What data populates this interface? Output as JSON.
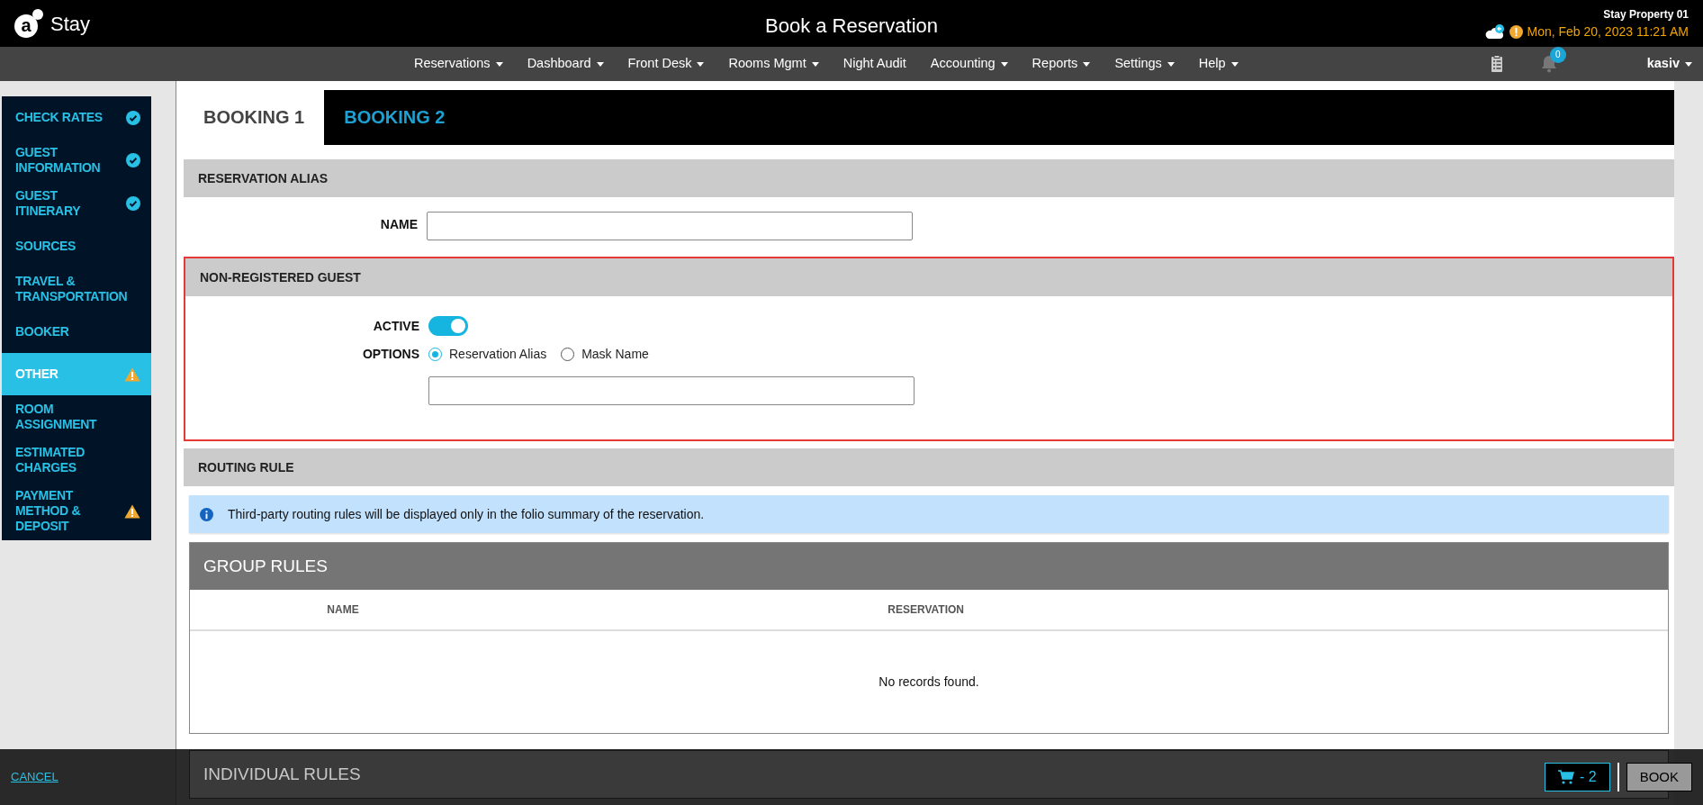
{
  "header": {
    "logo_mark": "a",
    "logo_name": "Stay",
    "title": "Book a Reservation",
    "property": "Stay Property 01",
    "datetime": "Mon, Feb 20, 2023 11:21 AM"
  },
  "nav": {
    "items": [
      {
        "label": "Reservations",
        "has_menu": true
      },
      {
        "label": "Dashboard",
        "has_menu": true
      },
      {
        "label": "Front Desk",
        "has_menu": true
      },
      {
        "label": "Rooms Mgmt",
        "has_menu": true
      },
      {
        "label": "Night Audit",
        "has_menu": false
      },
      {
        "label": "Accounting",
        "has_menu": true
      },
      {
        "label": "Reports",
        "has_menu": true
      },
      {
        "label": "Settings",
        "has_menu": true
      },
      {
        "label": "Help",
        "has_menu": true
      }
    ],
    "notification_count": "0",
    "user": "kasiv"
  },
  "sidebar": {
    "items": [
      {
        "label": "CHECK RATES",
        "completed": true,
        "warning": false,
        "selected": false
      },
      {
        "label": "GUEST INFORMATION",
        "completed": true,
        "warning": false,
        "selected": false
      },
      {
        "label": "GUEST ITINERARY",
        "completed": true,
        "warning": false,
        "selected": false
      },
      {
        "label": "SOURCES",
        "completed": false,
        "warning": false,
        "selected": false
      },
      {
        "label": "TRAVEL & TRANSPORTATION",
        "completed": false,
        "warning": false,
        "selected": false
      },
      {
        "label": "BOOKER",
        "completed": false,
        "warning": false,
        "selected": false
      },
      {
        "label": "OTHER",
        "completed": false,
        "warning": true,
        "selected": true
      },
      {
        "label": "ROOM ASSIGNMENT",
        "completed": false,
        "warning": false,
        "selected": false
      },
      {
        "label": "ESTIMATED CHARGES",
        "completed": false,
        "warning": false,
        "selected": false
      },
      {
        "label": "PAYMENT METHOD & DEPOSIT",
        "completed": false,
        "warning": true,
        "selected": false
      }
    ]
  },
  "tabs": [
    {
      "label": "BOOKING 1",
      "selected": true
    },
    {
      "label": "BOOKING 2",
      "selected": false
    }
  ],
  "reservation_alias": {
    "title": "RESERVATION ALIAS",
    "name_label": "NAME"
  },
  "non_registered_guest": {
    "title": "NON-REGISTERED GUEST",
    "highlighted": true,
    "active_label": "ACTIVE",
    "active": true,
    "options_label": "OPTIONS",
    "options": [
      {
        "label": "Reservation Alias",
        "selected": true
      },
      {
        "label": "Mask Name",
        "selected": false
      }
    ]
  },
  "routing_rule": {
    "title": "ROUTING RULE",
    "info": "Third-party routing rules will be displayed only in the folio summary of the reservation.",
    "group_rules": {
      "title": "GROUP RULES",
      "columns": [
        "NAME",
        "RESERVATION"
      ],
      "empty_text": "No records found."
    },
    "individual_rules": {
      "title": "INDIVIDUAL RULES"
    }
  },
  "footer": {
    "cancel": "CANCEL",
    "cart": "- 2",
    "book": "BOOK"
  }
}
